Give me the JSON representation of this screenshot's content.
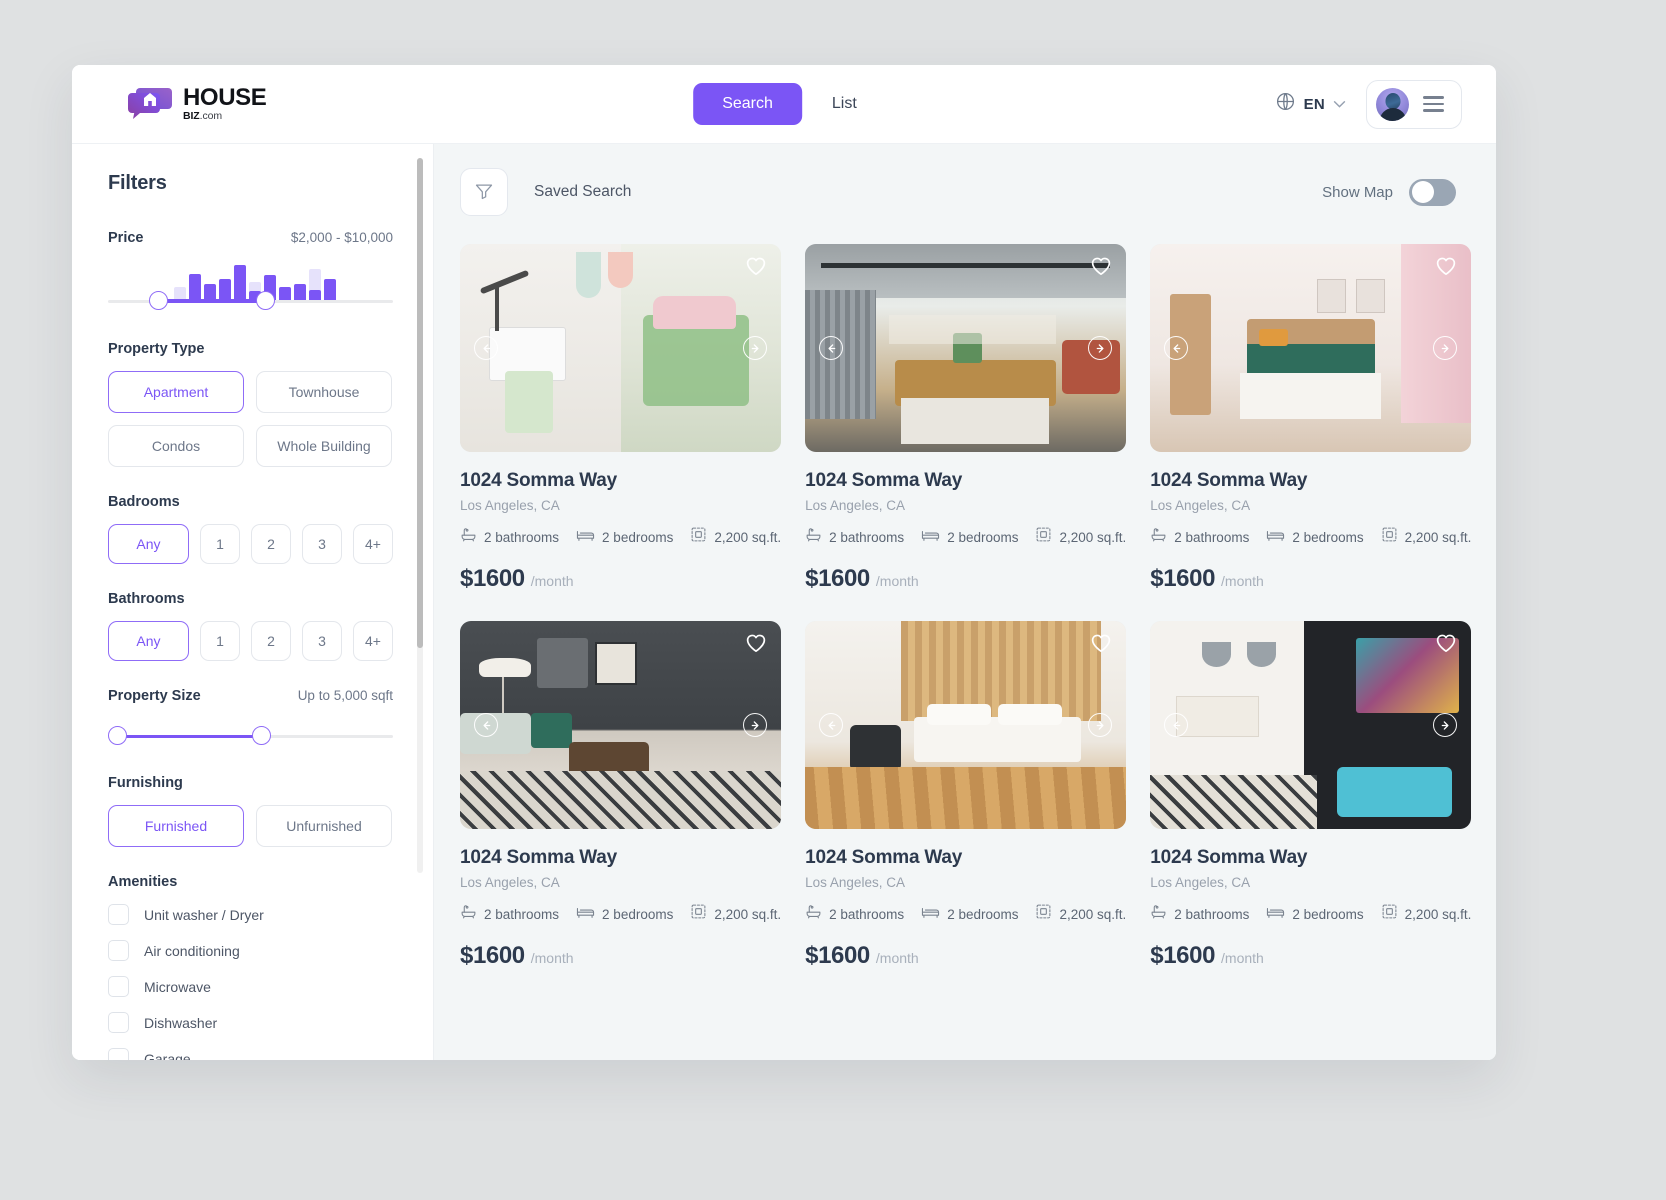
{
  "brand": {
    "name": "HOUSE",
    "sub_bold": "BIZ",
    "sub_light": ".com",
    "accent_color": "#7b55f5"
  },
  "header": {
    "search_label": "Search",
    "list_label": "List",
    "language": "EN",
    "globe_icon": "globe-icon",
    "chevron_icon": "chevron-down-icon",
    "avatar_icon": "user-avatar",
    "menu_icon": "hamburger-menu-icon"
  },
  "sidebar": {
    "title": "Filters",
    "price": {
      "label": "Price",
      "value": "$2,000 - $10,000",
      "histogram": [
        38,
        75,
        48,
        60,
        100,
        52,
        72,
        38,
        46,
        88,
        60
      ],
      "histogram_filled": [
        0,
        75,
        48,
        60,
        100,
        28,
        72,
        38,
        46,
        30,
        60
      ]
    },
    "property_type": {
      "label": "Property Type",
      "options": [
        {
          "label": "Apartment",
          "selected": true
        },
        {
          "label": "Townhouse",
          "selected": false
        },
        {
          "label": "Condos",
          "selected": false
        },
        {
          "label": "Whole Building",
          "selected": false
        }
      ]
    },
    "bedrooms": {
      "label": "Badrooms",
      "options": [
        {
          "label": "Any",
          "selected": true
        },
        {
          "label": "1",
          "selected": false
        },
        {
          "label": "2",
          "selected": false
        },
        {
          "label": "3",
          "selected": false
        },
        {
          "label": "4+",
          "selected": false
        }
      ]
    },
    "bathrooms": {
      "label": "Bathrooms",
      "options": [
        {
          "label": "Any",
          "selected": true
        },
        {
          "label": "1",
          "selected": false
        },
        {
          "label": "2",
          "selected": false
        },
        {
          "label": "3",
          "selected": false
        },
        {
          "label": "4+",
          "selected": false
        }
      ]
    },
    "property_size": {
      "label": "Property Size",
      "value": "Up to 5,000 sqft"
    },
    "furnishing": {
      "label": "Furnishing",
      "options": [
        {
          "label": "Furnished",
          "selected": true
        },
        {
          "label": "Unfurnished",
          "selected": false
        }
      ]
    },
    "amenities": {
      "label": "Amenities",
      "items": [
        {
          "label": "Unit washer / Dryer",
          "checked": false
        },
        {
          "label": "Air conditioning",
          "checked": false
        },
        {
          "label": "Microwave",
          "checked": false
        },
        {
          "label": "Dishwasher",
          "checked": false
        },
        {
          "label": "Garage",
          "checked": false
        }
      ]
    }
  },
  "results": {
    "filter_icon": "filter-funnel-icon",
    "saved_search_label": "Saved Search",
    "show_map_label": "Show Map",
    "show_map_on": false,
    "cards": [
      {
        "title": "1024 Somma Way",
        "city": "Los Angeles, CA",
        "bathrooms": "2 bathrooms",
        "bedrooms": "2 bedrooms",
        "area": "2,200 sq.ft.",
        "price": "$1600",
        "period": "/month",
        "photo": "bedroom-desk-pink"
      },
      {
        "title": "1024 Somma Way",
        "city": "Los Angeles, CA",
        "bathrooms": "2 bathrooms",
        "bedrooms": "2 bedrooms",
        "area": "2,200 sq.ft.",
        "price": "$1600",
        "period": "/month",
        "photo": "industrial-kitchen"
      },
      {
        "title": "1024 Somma Way",
        "city": "Los Angeles, CA",
        "bathrooms": "2 bathrooms",
        "bedrooms": "2 bedrooms",
        "area": "2,200 sq.ft.",
        "price": "$1600",
        "period": "/month",
        "photo": "pink-curtain-bedroom"
      },
      {
        "title": "1024 Somma Way",
        "city": "Los Angeles, CA",
        "bathrooms": "2 bathrooms",
        "bedrooms": "2 bedrooms",
        "area": "2,200 sq.ft.",
        "price": "$1600",
        "period": "/month",
        "photo": "dark-living-room"
      },
      {
        "title": "1024 Somma Way",
        "city": "Los Angeles, CA",
        "bathrooms": "2 bathrooms",
        "bedrooms": "2 bedrooms",
        "area": "2,200 sq.ft.",
        "price": "$1600",
        "period": "/month",
        "photo": "wood-panel-bedroom"
      },
      {
        "title": "1024 Somma Way",
        "city": "Los Angeles, CA",
        "bathrooms": "2 bathrooms",
        "bedrooms": "2 bedrooms",
        "area": "2,200 sq.ft.",
        "price": "$1600",
        "period": "/month",
        "photo": "teal-accent-bedroom"
      }
    ]
  }
}
